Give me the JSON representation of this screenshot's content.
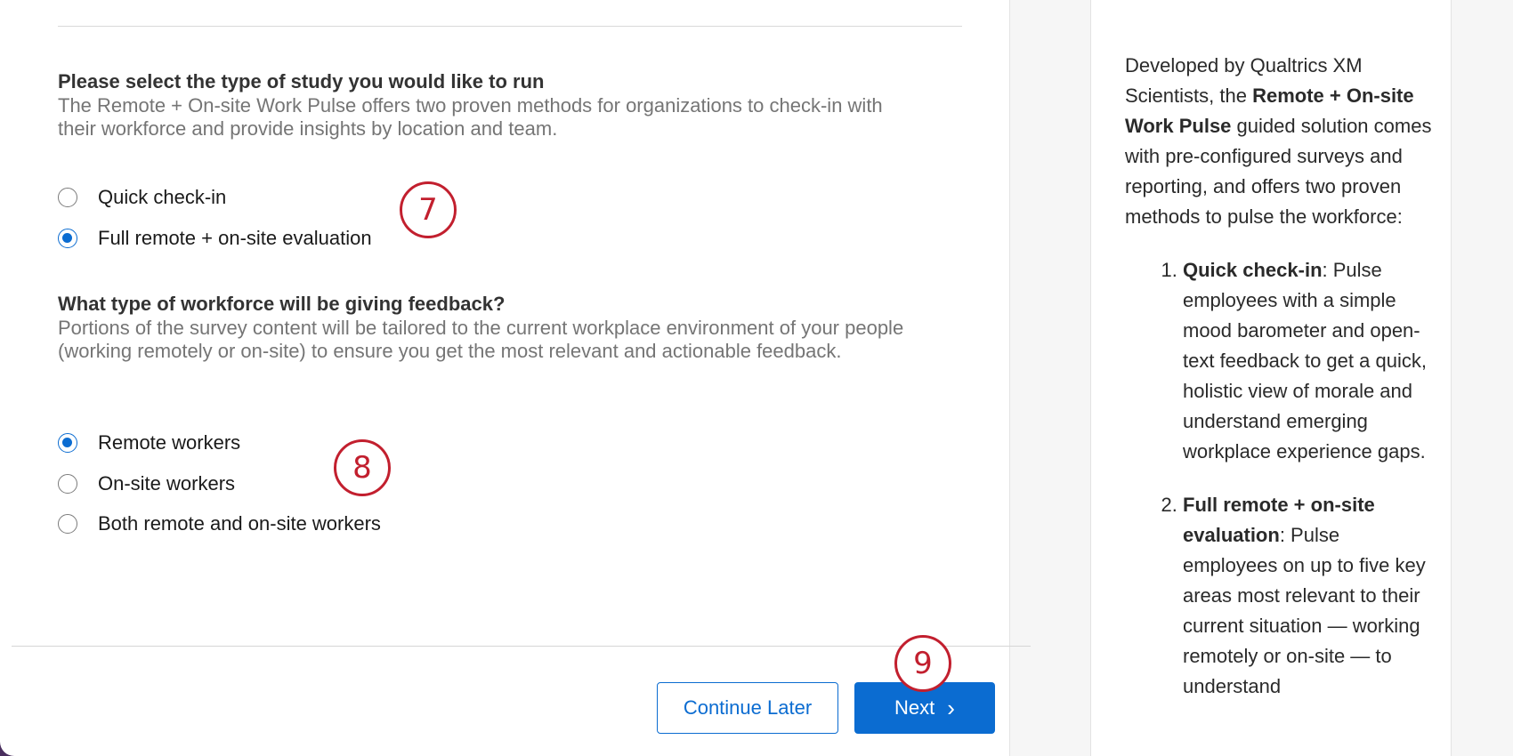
{
  "study_section": {
    "title": "Please select the type of study you would like to run",
    "description": "The Remote + On-site Work Pulse offers two proven methods for organizations to check-in with their workforce and provide insights by location and team.",
    "options": [
      {
        "label": "Quick check-in",
        "selected": false
      },
      {
        "label": "Full remote + on-site evaluation",
        "selected": true
      }
    ]
  },
  "workforce_section": {
    "title": "What type of workforce will be giving feedback?",
    "description": "Portions of the survey content will be tailored to the current workplace environment of your people (working remotely or on-site) to ensure you get the most relevant and actionable feedback.",
    "options": [
      {
        "label": "Remote workers",
        "selected": true
      },
      {
        "label": "On-site workers",
        "selected": false
      },
      {
        "label": "Both remote and on-site workers",
        "selected": false
      }
    ]
  },
  "callouts": {
    "c7": "7",
    "c8": "8",
    "c9": "9"
  },
  "footer": {
    "continue_later_label": "Continue Later",
    "next_label": "Next",
    "next_icon": "chevron-right-icon"
  },
  "info_panel": {
    "intro_1": "Developed by Qualtrics XM Scientists, the ",
    "intro_bold": "Remote + On-site Work Pulse",
    "intro_2": " guided solution comes with pre-configured surveys and reporting, and offers two proven methods to pulse the workforce:",
    "item1_bold": "Quick check-in",
    "item1_text": ": Pulse employees with a simple mood barometer and open-text feedback to get a quick, holistic view of morale and understand emerging workplace experience gaps.",
    "item2_bold": "Full remote + on-site evaluation",
    "item2_text": ": Pulse employees on up to five key areas most relevant to their current situation — working remotely or on-site — to understand"
  },
  "colors": {
    "accent": "#0b6cd1",
    "callout": "#c21f2e"
  }
}
